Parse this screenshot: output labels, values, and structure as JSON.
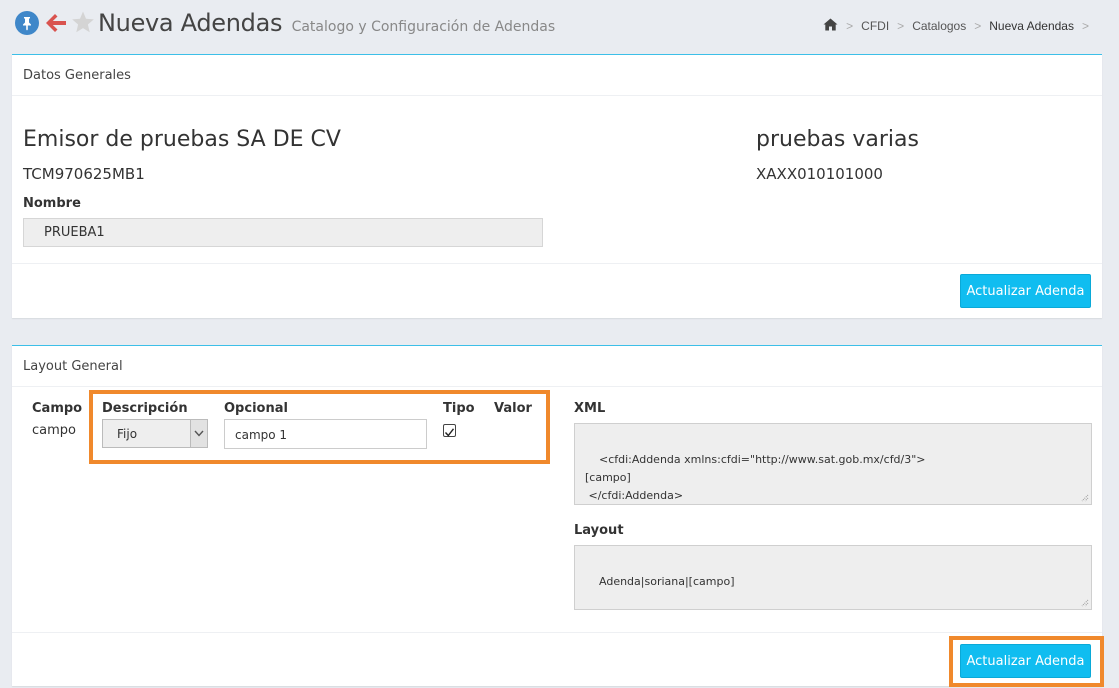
{
  "header": {
    "title": "Nueva Adendas",
    "subtitle": "Catalogo y Configuración de Adendas",
    "breadcrumb": [
      "CFDI",
      "Catalogos",
      "Nueva Adendas"
    ]
  },
  "datos_generales": {
    "heading": "Datos Generales",
    "emisor_name": "Emisor de pruebas SA DE CV",
    "emisor_rfc": "TCM970625MB1",
    "receptor_name": "pruebas varias",
    "receptor_rfc": "XAXX010101000",
    "nombre_label": "Nombre",
    "nombre_value": "PRUEBA1",
    "update_button": "Actualizar Adenda"
  },
  "layout_general": {
    "heading": "Layout General",
    "columns": {
      "campo": "Campo",
      "descripcion": "Descripción",
      "opcional": "Opcional",
      "tipo": "Tipo",
      "valor": "Valor"
    },
    "row": {
      "campo": "campo",
      "descripcion_selected": "Fijo",
      "opcional_value": "campo 1",
      "tipo_checked": true
    },
    "xml_label": "XML",
    "xml_value": "<cfdi:Addenda xmlns:cfdi=\"http://www.sat.gob.mx/cfd/3\">\n[campo]\n </cfdi:Addenda>",
    "layout_label": "Layout",
    "layout_value": "Adenda|soriana|[campo]",
    "update_button": "Actualizar Adenda"
  },
  "colors": {
    "accent": "#10bdf0",
    "highlight": "#f0892c",
    "back_arrow": "#d9534f",
    "pin": "#3f87c9"
  }
}
